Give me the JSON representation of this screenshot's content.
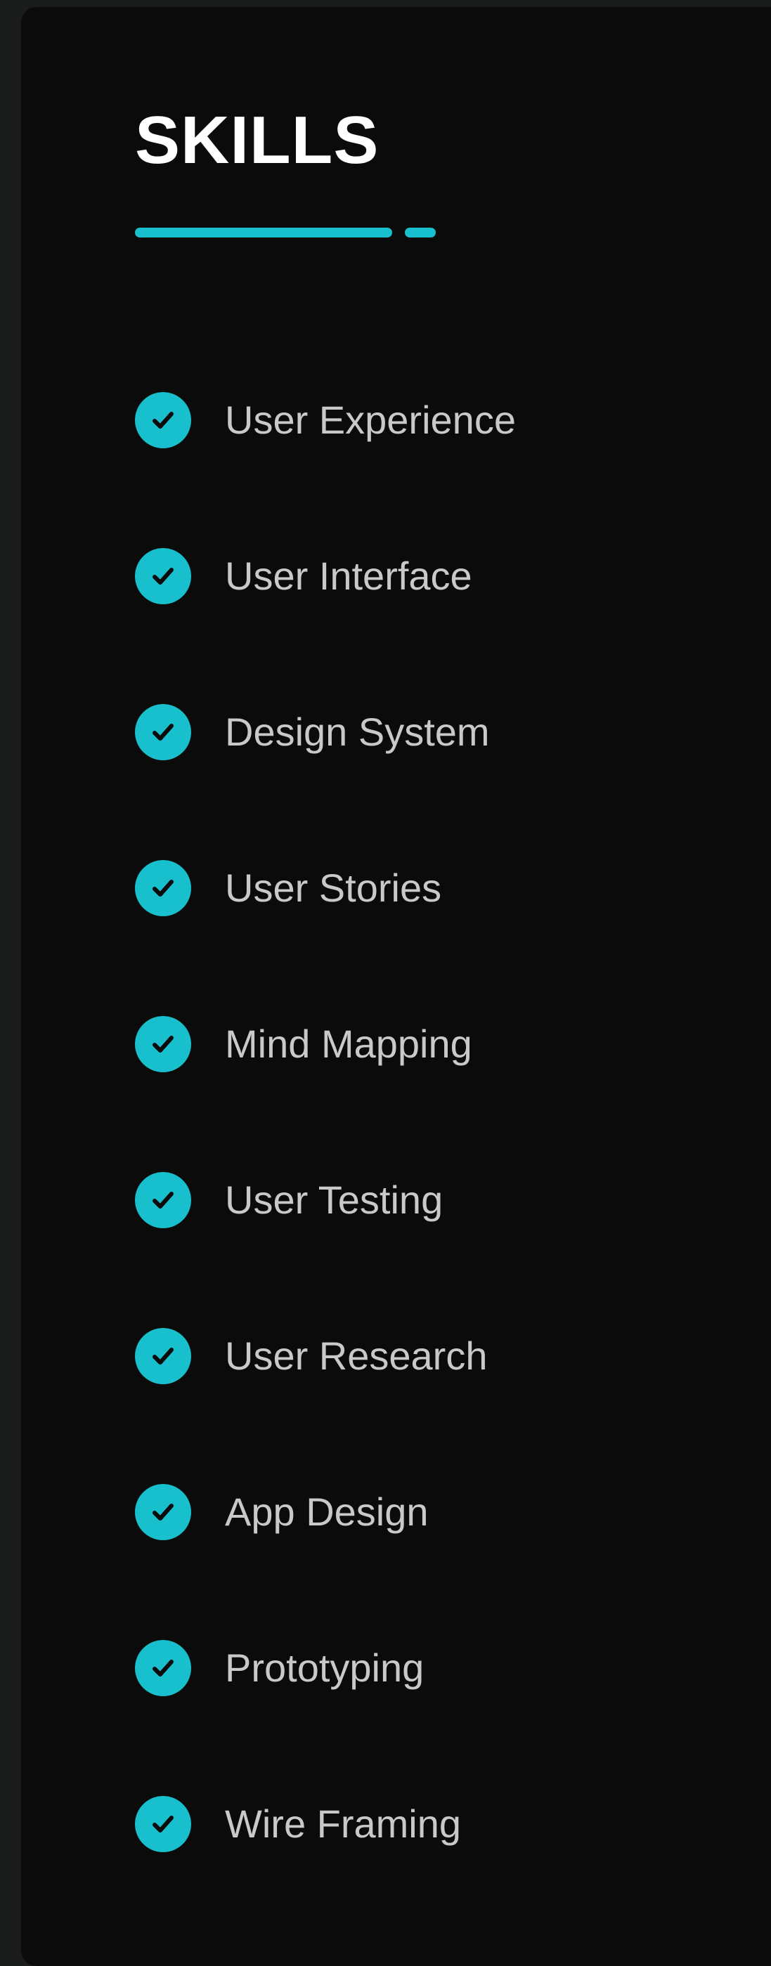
{
  "section": {
    "title": "SKILLS"
  },
  "colors": {
    "accent": "#18bfcc",
    "background": "#0b0b0b",
    "title": "#ffffff",
    "text": "#c9c9c9",
    "check_mark": "#0b0b0b"
  },
  "skills": [
    {
      "label": "User Experience",
      "icon": "check-circle-icon"
    },
    {
      "label": "User Interface",
      "icon": "check-circle-icon"
    },
    {
      "label": "Design System",
      "icon": "check-circle-icon"
    },
    {
      "label": "User Stories",
      "icon": "check-circle-icon"
    },
    {
      "label": "Mind Mapping",
      "icon": "check-circle-icon"
    },
    {
      "label": "User Testing",
      "icon": "check-circle-icon"
    },
    {
      "label": "User Research",
      "icon": "check-circle-icon"
    },
    {
      "label": "App Design",
      "icon": "check-circle-icon"
    },
    {
      "label": "Prototyping",
      "icon": "check-circle-icon"
    },
    {
      "label": "Wire Framing",
      "icon": "check-circle-icon"
    }
  ]
}
